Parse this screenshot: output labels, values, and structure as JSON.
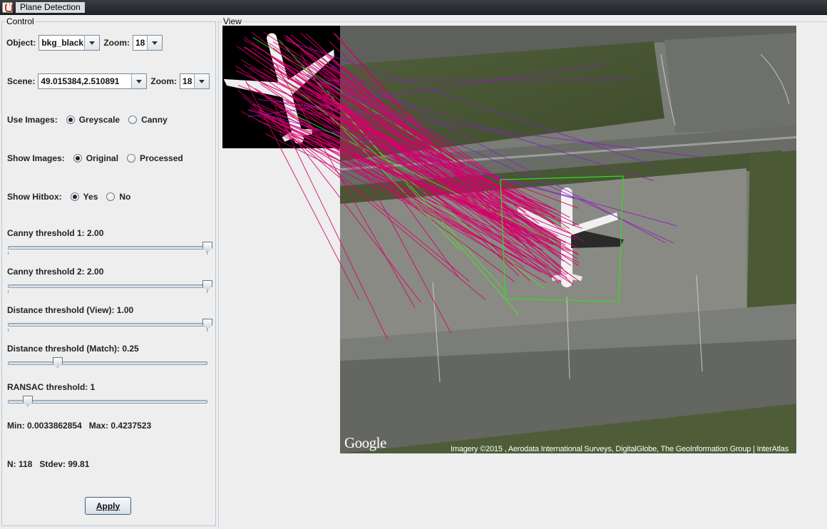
{
  "window": {
    "title": "Plane Detection",
    "app_icon": "java-cup-icon"
  },
  "control": {
    "legend": "Control",
    "object": {
      "label": "Object:",
      "value": "bkg_black",
      "zoom_label": "Zoom:",
      "zoom_value": "18"
    },
    "scene": {
      "label": "Scene:",
      "value": "49.015384,2.510891",
      "zoom_label": "Zoom:",
      "zoom_value": "18"
    },
    "use_images": {
      "label": "Use Images:",
      "options": [
        "Greyscale",
        "Canny"
      ],
      "selected": "Greyscale"
    },
    "show_images": {
      "label": "Show Images:",
      "options": [
        "Original",
        "Processed"
      ],
      "selected": "Original"
    },
    "show_hitbox": {
      "label": "Show Hitbox:",
      "options": [
        "Yes",
        "No"
      ],
      "selected": "Yes"
    },
    "sliders": [
      {
        "label": "Canny threshold 1: 2.00",
        "fraction": 1.0
      },
      {
        "label": "Canny threshold 2: 2.00",
        "fraction": 1.0
      },
      {
        "label": "Distance threshold (View): 1.00",
        "fraction": 1.0
      },
      {
        "label": "Distance threshold (Match): 0.25",
        "fraction": 0.25
      },
      {
        "label": "RANSAC threshold: 1",
        "fraction": 0.1
      }
    ],
    "stats": {
      "minmax": "Min: 0.0033862854   Max: 0.4237523",
      "n_stdev": "N: 118   Stdev: 99.81"
    },
    "apply_label": "Apply"
  },
  "view": {
    "legend": "View",
    "google_logo": "Google",
    "attribution": "Imagery ©2015 , Aerodata International Surveys, DigitalGlobe, The GeoInformation Group | InterAtlas",
    "colors": {
      "match_line": "#d4006b",
      "inlier_line": "#44ee22",
      "outlier_line": "#8a1fc0",
      "hitbox": "#33dd22"
    }
  }
}
